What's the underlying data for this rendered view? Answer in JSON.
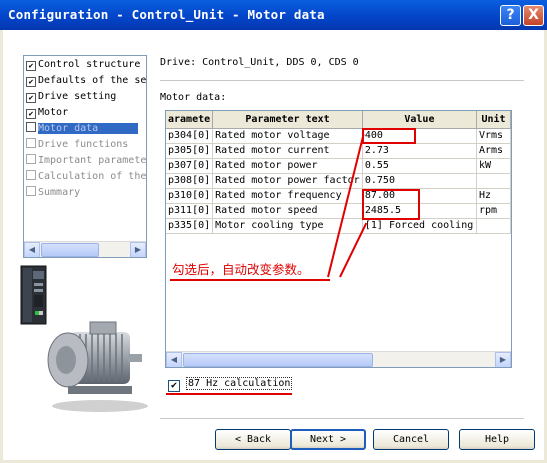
{
  "window": {
    "title": "Configuration - Control_Unit - Motor data",
    "help_glyph": "?",
    "close_glyph": "X"
  },
  "nav": {
    "items": [
      {
        "label": "Control structure",
        "checked": true,
        "state": "normal"
      },
      {
        "label": "Defaults of the se",
        "checked": true,
        "state": "normal"
      },
      {
        "label": "Drive setting",
        "checked": true,
        "state": "normal"
      },
      {
        "label": "Motor",
        "checked": true,
        "state": "normal"
      },
      {
        "label": "Motor data",
        "checked": false,
        "state": "selected"
      },
      {
        "label": "Drive functions",
        "checked": false,
        "state": "gray"
      },
      {
        "label": "Important paramete",
        "checked": false,
        "state": "gray"
      },
      {
        "label": "Calculation of the",
        "checked": false,
        "state": "gray"
      },
      {
        "label": "Summary",
        "checked": false,
        "state": "gray"
      }
    ]
  },
  "main": {
    "drive_line": "Drive: Control_Unit, DDS 0, CDS 0",
    "section_label": "Motor data:"
  },
  "table": {
    "headers": {
      "param": "aramete",
      "text": "Parameter text",
      "value": "Value",
      "unit": "Unit"
    },
    "rows": [
      {
        "param": "p304[0]",
        "text": "Rated motor voltage",
        "value": "400",
        "unit": "Vrms"
      },
      {
        "param": "p305[0]",
        "text": "Rated motor current",
        "value": "2.73",
        "unit": "Arms"
      },
      {
        "param": "p307[0]",
        "text": "Rated motor power",
        "value": "0.55",
        "unit": "kW"
      },
      {
        "param": "p308[0]",
        "text": "Rated motor power factor",
        "value": "0.750",
        "unit": ""
      },
      {
        "param": "p310[0]",
        "text": "Rated motor frequency",
        "value": "87.00",
        "unit": "Hz"
      },
      {
        "param": "p311[0]",
        "text": "Rated motor speed",
        "value": "2485.5",
        "unit": "rpm"
      },
      {
        "param": "p335[0]",
        "text": "Motor cooling type",
        "value": "[1] Forced cooling",
        "unit": ""
      }
    ]
  },
  "annotation": {
    "text": "勾选后，自动改变参数。",
    "color": "#e00000"
  },
  "checkbox_87hz": {
    "label": "87 Hz calculation",
    "checked": true,
    "check_glyph": "✔"
  },
  "buttons": {
    "back": "< Back",
    "next": "Next >",
    "cancel": "Cancel",
    "help": "Help"
  },
  "scroll_arrows": {
    "left": "◀",
    "right": "▶"
  },
  "colors": {
    "title_bar": "#0445c9",
    "selection": "#316ac5",
    "window_bg": "#ece9d8"
  },
  "icons": [
    "help-icon",
    "close-icon",
    "checkbox-icon",
    "scroll-left-icon",
    "scroll-right-icon",
    "drive-unit-icon",
    "motor-image"
  ]
}
